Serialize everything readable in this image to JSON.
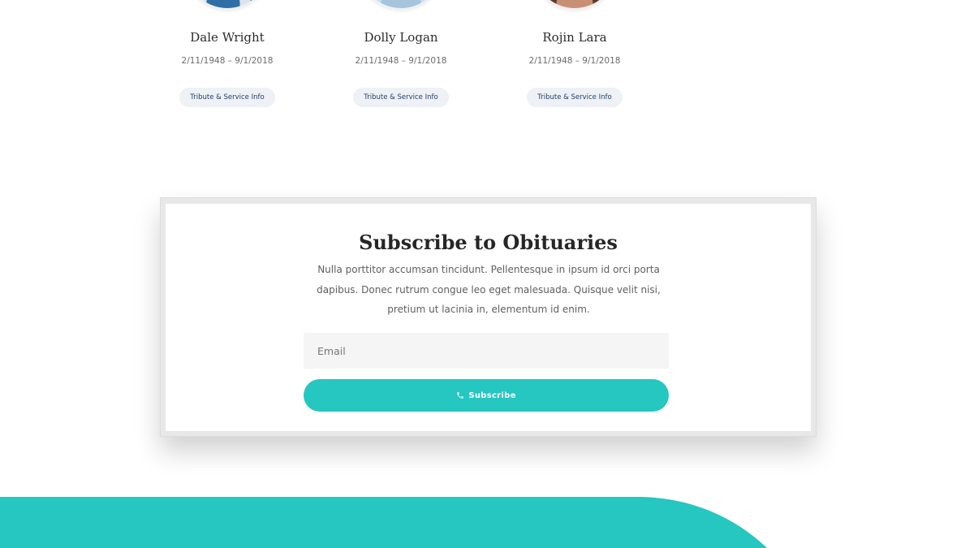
{
  "obituaries": [
    {
      "name": "Dale Wright",
      "dates": "2/11/1948 – 9/1/2018",
      "button": "Tribute & Service Info"
    },
    {
      "name": "Dolly Logan",
      "dates": "2/11/1948 – 9/1/2018",
      "button": "Tribute & Service Info"
    },
    {
      "name": "Rojin Lara",
      "dates": "2/11/1948 – 9/1/2018",
      "button": "Tribute & Service Info"
    }
  ],
  "subscribe": {
    "title": "Subscribe to Obituaries",
    "description": "Nulla porttitor accumsan tincidunt. Pellentesque in ipsum id orci porta dapibus. Donec rutrum congue leo eget malesuada. Quisque velit nisi, pretium ut lacinia in, elementum id enim.",
    "email_placeholder": "Email",
    "email_value": "",
    "button_label": "Subscribe",
    "button_icon": "phone-icon"
  },
  "colors": {
    "accent": "#26c6c1",
    "tribute_button_bg": "#eef1f5",
    "tribute_button_text": "#1f3f6e"
  }
}
